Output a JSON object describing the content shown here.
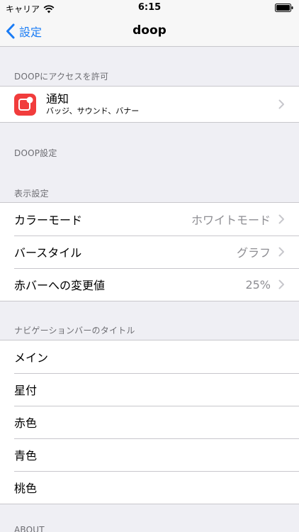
{
  "status_bar": {
    "carrier": "キャリア",
    "time": "6:15"
  },
  "nav": {
    "back_label": "設定",
    "title": "doop"
  },
  "sections": {
    "access": {
      "header": "DOOPにアクセスを許可",
      "notifications": {
        "title": "通知",
        "subtitle": "バッジ、サウンド、バナー"
      }
    },
    "doop_settings": {
      "header": "DOOP設定"
    },
    "display": {
      "header": "表示設定",
      "rows": [
        {
          "label": "カラーモード",
          "value": "ホワイトモード"
        },
        {
          "label": "バースタイル",
          "value": "グラフ"
        },
        {
          "label": "赤バーへの変更値",
          "value": "25%"
        }
      ]
    },
    "nav_title": {
      "header": "ナビゲーションバーのタイトル",
      "rows": [
        {
          "label": "メイン"
        },
        {
          "label": "星付"
        },
        {
          "label": "赤色"
        },
        {
          "label": "青色"
        },
        {
          "label": "桃色"
        }
      ]
    },
    "about": {
      "header": "ABOUT"
    }
  },
  "colors": {
    "accent": "#1a7cf5",
    "app_icon": "#f13c3c",
    "background": "#efeff4"
  }
}
